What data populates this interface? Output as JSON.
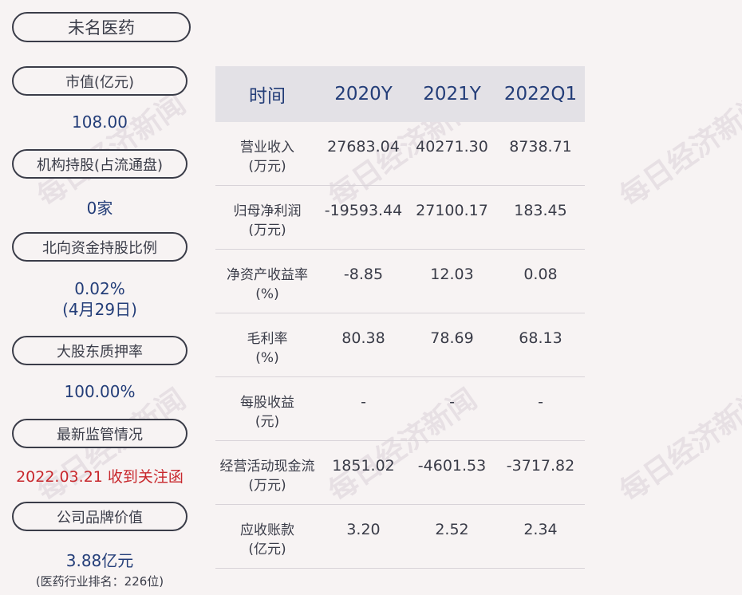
{
  "company": "未名医药",
  "left_panel": [
    {
      "label": "市值(亿元)",
      "value": "108.00"
    },
    {
      "label": "机构持股(占流通盘)",
      "value": "0家"
    },
    {
      "label": "北向资金持股比例",
      "value": "0.02%",
      "value2": "(4月29日)"
    },
    {
      "label": "大股东质押率",
      "value": "100.00%"
    },
    {
      "label": "最新监管情况",
      "value": "2022.03.21 收到关注函"
    },
    {
      "label": "公司品牌价值",
      "value": "3.88亿元",
      "sub": "(医药行业排名：226位)"
    }
  ],
  "table": {
    "headers": [
      "时间",
      "2020Y",
      "2021Y",
      "2022Q1"
    ],
    "rows": [
      {
        "name": "营业收入",
        "unit": "(万元)",
        "values": [
          "27683.04",
          "40271.30",
          "8738.71"
        ]
      },
      {
        "name": "归母净利润",
        "unit": "(万元)",
        "values": [
          "-19593.44",
          "27100.17",
          "183.45"
        ]
      },
      {
        "name": "净资产收益率",
        "unit": "(%)",
        "values": [
          "-8.85",
          "12.03",
          "0.08"
        ]
      },
      {
        "name": "毛利率",
        "unit": "(%)",
        "values": [
          "80.38",
          "78.69",
          "68.13"
        ]
      },
      {
        "name": "每股收益",
        "unit": "(元)",
        "values": [
          "-",
          "-",
          "-"
        ]
      },
      {
        "name": "经营活动现金流",
        "unit": "(万元)",
        "values": [
          "1851.02",
          "-4601.53",
          "-3717.82"
        ]
      },
      {
        "name": "应收账款",
        "unit": "(亿元)",
        "values": [
          "3.20",
          "2.52",
          "2.34"
        ]
      }
    ]
  },
  "watermark": "每日经济新闻"
}
